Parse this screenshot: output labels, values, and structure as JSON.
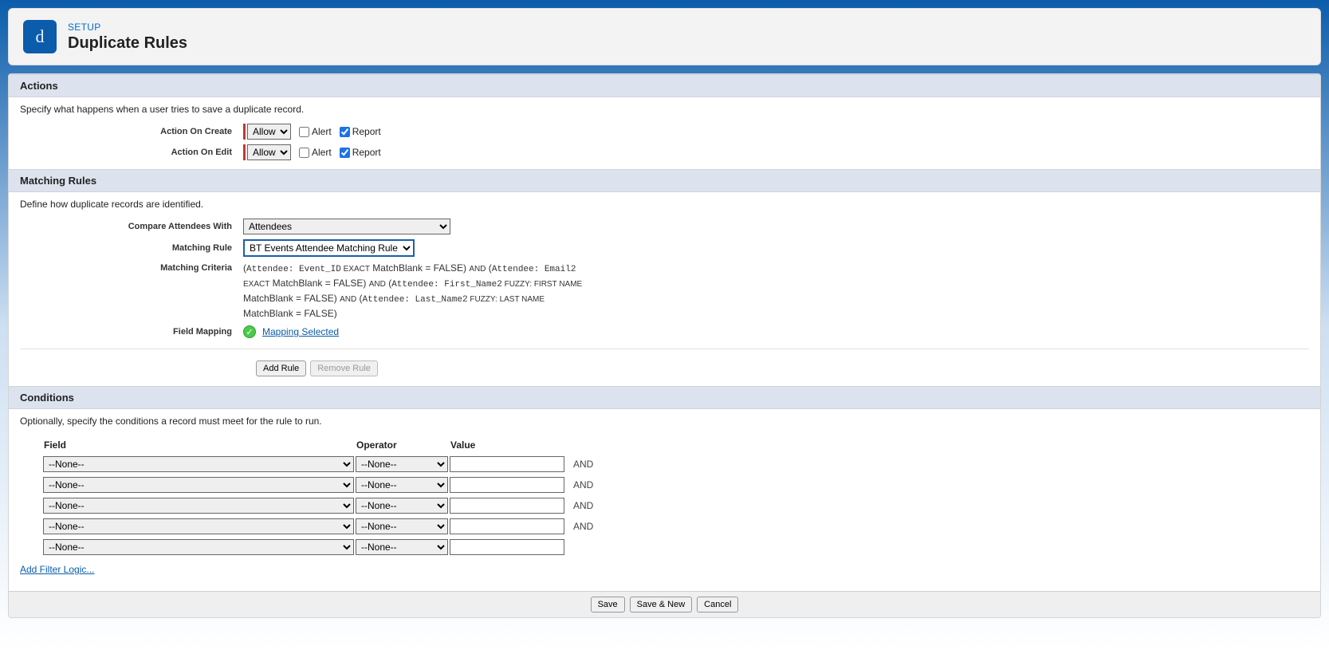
{
  "header": {
    "icon_letter": "d",
    "breadcrumb": "SETUP",
    "title": "Duplicate Rules"
  },
  "actions": {
    "section_title": "Actions",
    "description": "Specify what happens when a user tries to save a duplicate record.",
    "on_create_label": "Action On Create",
    "on_edit_label": "Action On Edit",
    "allow_option": "Allow",
    "alert_label": "Alert",
    "report_label": "Report",
    "create_alert_checked": false,
    "create_report_checked": true,
    "edit_alert_checked": false,
    "edit_report_checked": true
  },
  "matching": {
    "section_title": "Matching Rules",
    "description": "Define how duplicate records are identified.",
    "compare_label": "Compare Attendees With",
    "compare_value": "Attendees",
    "rule_label": "Matching Rule",
    "rule_value": "BT Events Attendee Matching Rule",
    "criteria_label": "Matching Criteria",
    "criteria_parts": {
      "p1a": "(",
      "p1b": "Attendee: Event_ID",
      "p1c": " EXACT",
      "p1d": " MatchBlank = FALSE) ",
      "and1": "AND",
      "p2a": " (",
      "p2b": "Attendee: Email2",
      "p2c": " EXACT",
      "p2d": " MatchBlank = FALSE) ",
      "and2": "AND",
      "p3a": " (",
      "p3b": "Attendee: First_Name2",
      "p3c": " FUZZY: FIRST NAME",
      "p3d": " MatchBlank = FALSE) ",
      "and3": "AND",
      "p4a": " (",
      "p4b": "Attendee: Last_Name2",
      "p4c": " FUZZY: LAST NAME",
      "p4d": " MatchBlank = FALSE)"
    },
    "mapping_label": "Field Mapping",
    "mapping_value": "Mapping Selected",
    "add_rule_btn": "Add Rule",
    "remove_rule_btn": "Remove Rule"
  },
  "conditions": {
    "section_title": "Conditions",
    "description": "Optionally, specify the conditions a record must meet for the rule to run.",
    "field_header": "Field",
    "operator_header": "Operator",
    "value_header": "Value",
    "none_option": "--None--",
    "and_label": "AND",
    "rows": 5,
    "add_filter_logic": "Add Filter Logic..."
  },
  "footer": {
    "save": "Save",
    "save_new": "Save & New",
    "cancel": "Cancel"
  }
}
